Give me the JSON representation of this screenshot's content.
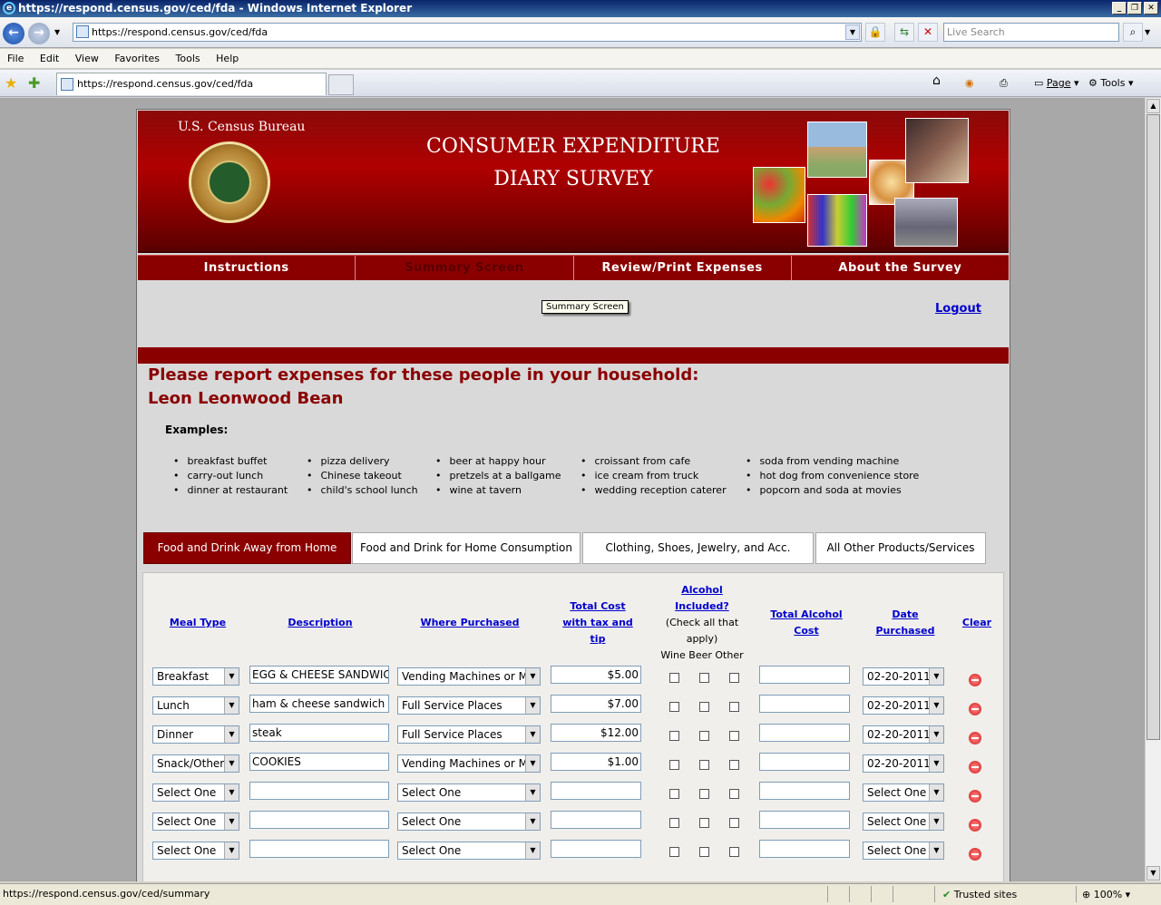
{
  "window": {
    "title": "https://respond.census.gov/ced/fda - Windows Internet Explorer"
  },
  "browser": {
    "url": "https://respond.census.gov/ced/fda",
    "search_placeholder": "Live Search",
    "menu": [
      "File",
      "Edit",
      "View",
      "Favorites",
      "Tools",
      "Help"
    ],
    "tab_title": "https://respond.census.gov/ced/fda",
    "page_label": "Page",
    "tools_label": "Tools"
  },
  "banner": {
    "bureau": "U.S. Census Bureau",
    "title_line1": "CONSUMER EXPENDITURE",
    "title_line2": "DIARY SURVEY"
  },
  "nav": [
    "Instructions",
    "Summary Screen",
    "Review/Print Expenses",
    "About the Survey"
  ],
  "tooltip": "Summary Screen",
  "logout": "Logout",
  "heading": {
    "line1": "Please report expenses for these people in your household:",
    "line2": "Leon Leonwood Bean"
  },
  "examples": {
    "label": "Examples:",
    "columns": [
      [
        "breakfast buffet",
        "carry-out lunch",
        "dinner at restaurant"
      ],
      [
        "pizza delivery",
        "Chinese takeout",
        "child's school lunch"
      ],
      [
        "beer at happy hour",
        "pretzels at a ballgame",
        "wine at tavern"
      ],
      [
        "croissant from cafe",
        "ice cream from truck",
        "wedding reception caterer"
      ],
      [
        "soda from vending machine",
        "hot dog from convenience store",
        "popcorn and soda at movies"
      ]
    ]
  },
  "category_tabs": [
    "Food and Drink Away from Home",
    "Food and Drink for Home Consumption",
    "Clothing, Shoes, Jewelry, and Acc.",
    "All Other Products/Services"
  ],
  "columns": {
    "meal_type": "Meal Type",
    "description": "Description",
    "where": "Where Purchased",
    "total_cost_1": "Total Cost",
    "total_cost_2": "with tax and",
    "total_cost_3": "tip",
    "alcohol_1": "Alcohol",
    "alcohol_2": "Included?",
    "alcohol_note_1": "(Check all that",
    "alcohol_note_2": "apply)",
    "alcohol_sub": "Wine Beer Other",
    "alcohol_cost_1": "Total Alcohol",
    "alcohol_cost_2": "Cost",
    "date_1": "Date",
    "date_2": "Purchased",
    "clear": "Clear"
  },
  "rows": [
    {
      "meal": "Breakfast",
      "desc": "EGG & CHEESE SANDWICH",
      "where": "Vending Machines or Mobile Vendors",
      "cost": "$5.00",
      "date": "02-20-2011"
    },
    {
      "meal": "Lunch",
      "desc": "ham & cheese sandwich",
      "where": "Full Service Places",
      "cost": "$7.00",
      "date": "02-20-2011"
    },
    {
      "meal": "Dinner",
      "desc": "steak",
      "where": "Full Service Places",
      "cost": "$12.00",
      "date": "02-20-2011"
    },
    {
      "meal": "Snack/Other",
      "desc": "COOKIES",
      "where": "Vending Machines or Mobile Vendors",
      "cost": "$1.00",
      "date": "02-20-2011"
    },
    {
      "meal": "Select One",
      "desc": "",
      "where": "Select One",
      "cost": "",
      "date": "Select One"
    },
    {
      "meal": "Select One",
      "desc": "",
      "where": "Select One",
      "cost": "",
      "date": "Select One"
    },
    {
      "meal": "Select One",
      "desc": "",
      "where": "Select One",
      "cost": "",
      "date": "Select One"
    }
  ],
  "status": {
    "url": "https://respond.census.gov/ced/summary",
    "zone": "Trusted sites",
    "zoom": "100%"
  }
}
